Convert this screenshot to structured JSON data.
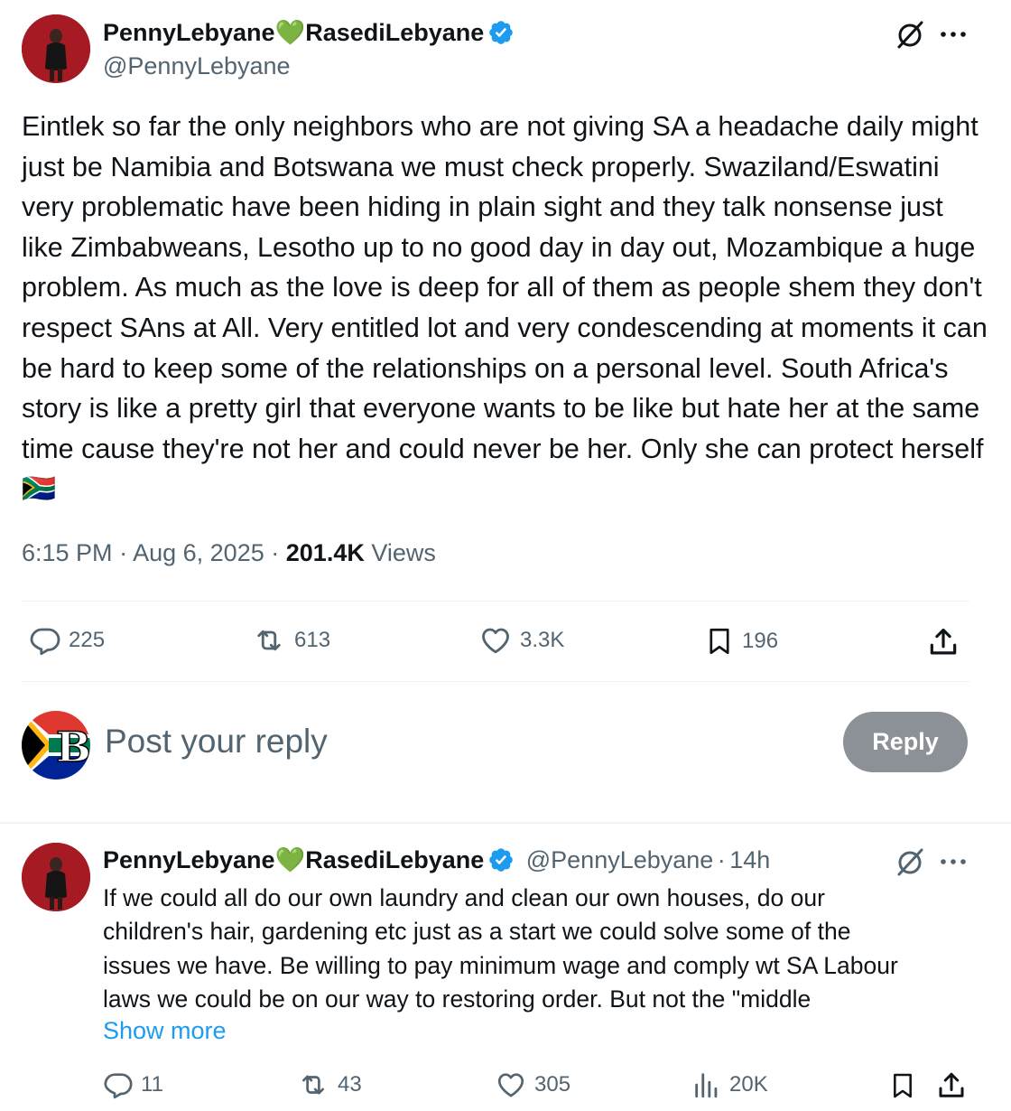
{
  "main_post": {
    "author_name": "PennyLebyane",
    "author_heart": "💚",
    "author_name_2": "RasediLebyane",
    "author_handle": "@PennyLebyane",
    "text": "Eintlek so far the only neighbors who are not giving SA a headache daily might just be Namibia and Botswana we must check properly. Swaziland/Eswatini very problematic have been hiding in plain sight and they talk nonsense just like Zimbabweans, Lesotho up to no good day in day out, Mozambique a huge problem. As much as the love is deep for all of them as people shem they don't respect SAns at All. Very entitled lot and very condescending at moments it can be hard to keep some of the relationships on a personal level. South Africa's story is like a pretty girl that everyone wants to be like but hate her at the same time cause they're not her and could never be her. Only she can protect herself",
    "flag_emoji": "🇿🇦",
    "time": "6:15 PM",
    "date": "Aug 6, 2025",
    "views_count": "201.4K",
    "views_label": "Views",
    "separator": "·",
    "stats": {
      "replies": "225",
      "reposts": "613",
      "likes": "3.3K",
      "bookmarks": "196"
    }
  },
  "composer": {
    "placeholder": "Post your reply",
    "reply_button": "Reply"
  },
  "reply_post": {
    "author_name": "PennyLebyane",
    "author_heart": "💚",
    "author_name_2": "RasediLebyane",
    "author_handle": "@PennyLebyane",
    "time_ago": "14h",
    "separator": "·",
    "lines": [
      "If we could all do our own laundry and clean our own houses, do our",
      "children's hair, gardening etc just as a start we could solve some of the",
      "issues we have. Be willing to pay minimum wage and comply wt SA Labour",
      "laws we could be on our way to restoring order. But not the \"middle"
    ],
    "show_more": "Show more",
    "stats": {
      "replies": "11",
      "reposts": "43",
      "likes": "305",
      "views": "20K"
    }
  },
  "icons": {
    "verified": "verified-badge-icon",
    "grok": "grok-icon",
    "more": "more-icon",
    "reply": "reply-icon",
    "repost": "repost-icon",
    "like": "like-icon",
    "bookmark": "bookmark-icon",
    "share": "share-icon",
    "views": "views-icon"
  },
  "colors": {
    "accent": "#1d9bf0",
    "secondary_text": "#536471",
    "reply_button_bg": "#8b9196"
  }
}
